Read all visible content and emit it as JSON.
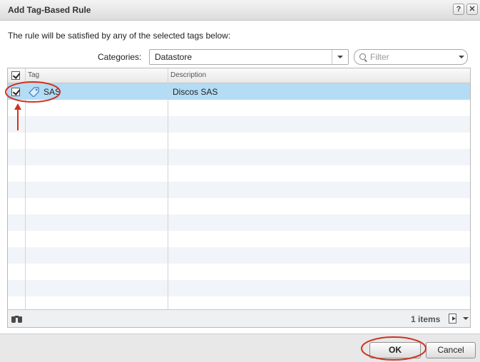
{
  "dialog": {
    "title": "Add Tag-Based Rule",
    "help_glyph": "?",
    "close_glyph": "✕"
  },
  "instruction": "The rule will be satisfied by any of the selected tags below:",
  "categories": {
    "label": "Categories:",
    "selected": "Datastore"
  },
  "filter": {
    "placeholder": "Filter"
  },
  "table": {
    "columns": [
      "Tag",
      "Description"
    ],
    "select_all_checked": true,
    "rows": [
      {
        "tag": "SAS",
        "description": "Discos SAS",
        "checked": true,
        "selected": true
      }
    ]
  },
  "grid_footer": {
    "count_label": "1 items"
  },
  "buttons": {
    "ok": "OK",
    "cancel": "Cancel"
  },
  "colors": {
    "selected_row": "#b4dcf4",
    "annotation": "#d0321e",
    "tag_icon": "#3a7cc0"
  },
  "icons": {
    "help": "help-icon",
    "close": "close-icon",
    "search": "search-icon",
    "tag": "tag-icon",
    "find": "binoculars-icon",
    "export": "export-icon"
  }
}
